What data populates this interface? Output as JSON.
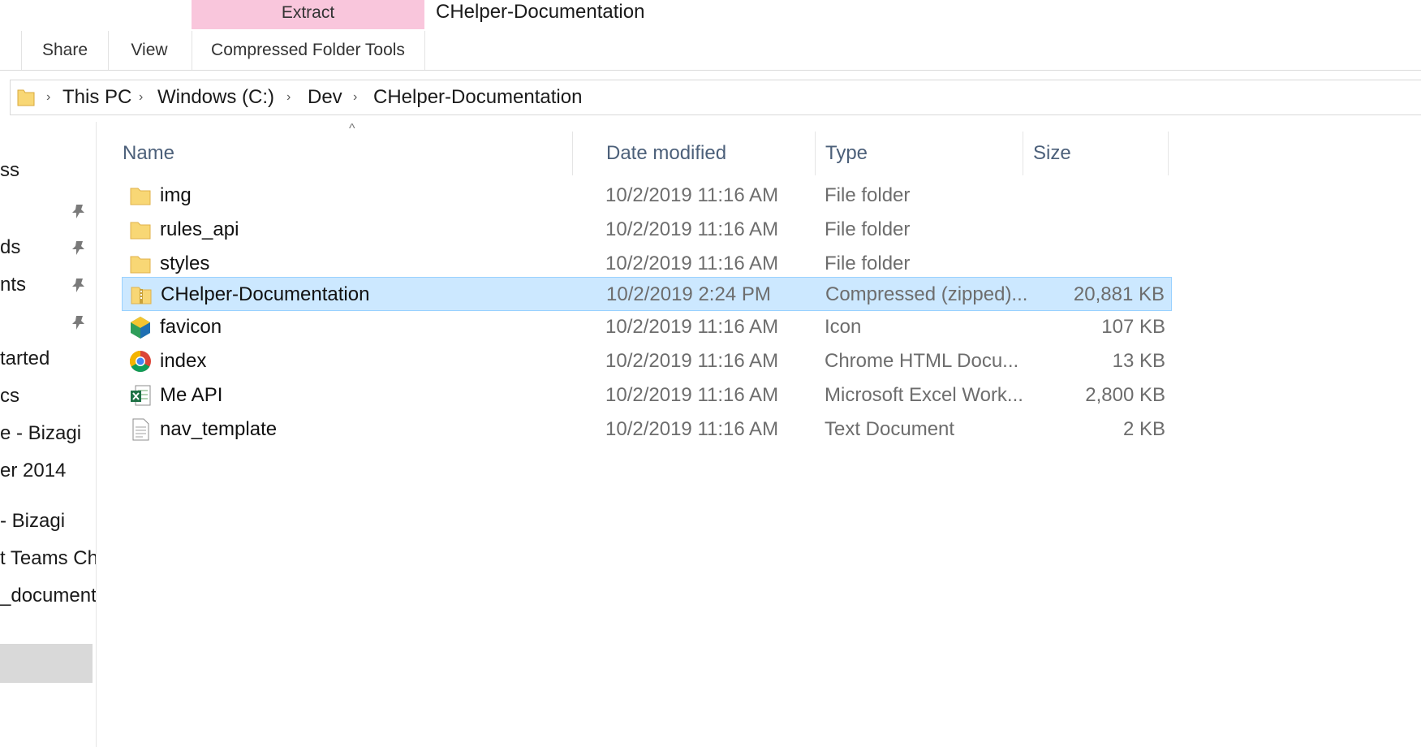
{
  "ribbon": {
    "context_tab_label": "Extract",
    "window_title": "CHelper-Documentation",
    "tabs": [
      {
        "label": "Share"
      },
      {
        "label": "View"
      },
      {
        "label": "Compressed Folder Tools"
      }
    ]
  },
  "address_bar": {
    "crumbs": [
      "This PC",
      "Windows (C:)",
      "Dev",
      "CHelper-Documentation"
    ],
    "separator": "›"
  },
  "nav_pane": {
    "items": [
      {
        "label": "ss",
        "pinned": false
      },
      {
        "label": "",
        "pinned": true
      },
      {
        "label": "ds",
        "pinned": true
      },
      {
        "label": "nts",
        "pinned": true
      },
      {
        "label": "",
        "pinned": true
      },
      {
        "label": "tarted",
        "pinned": false
      },
      {
        "label": "cs",
        "pinned": false
      },
      {
        "label": "e - Bizagi",
        "pinned": false
      },
      {
        "label": "er 2014",
        "pinned": false
      },
      {
        "label": "- Bizagi",
        "pinned": false
      },
      {
        "label": "t Teams Ch",
        "pinned": false
      },
      {
        "label": "_document",
        "pinned": false
      }
    ]
  },
  "file_list": {
    "columns": {
      "name": "Name",
      "date": "Date modified",
      "type": "Type",
      "size": "Size"
    },
    "sort_indicator": "^",
    "rows": [
      {
        "name": "img",
        "date": "10/2/2019 11:16 AM",
        "type": "File folder",
        "size": "",
        "icon": "folder-icon",
        "selected": false
      },
      {
        "name": "rules_api",
        "date": "10/2/2019 11:16 AM",
        "type": "File folder",
        "size": "",
        "icon": "folder-icon",
        "selected": false
      },
      {
        "name": "styles",
        "date": "10/2/2019 11:16 AM",
        "type": "File folder",
        "size": "",
        "icon": "folder-icon",
        "selected": false
      },
      {
        "name": "CHelper-Documentation",
        "date": "10/2/2019 2:24 PM",
        "type": "Compressed (zipped)...",
        "size": "20,881 KB",
        "icon": "zip-folder-icon",
        "selected": true
      },
      {
        "name": "favicon",
        "date": "10/2/2019 11:16 AM",
        "type": "Icon",
        "size": "107 KB",
        "icon": "favicon-icon",
        "selected": false
      },
      {
        "name": "index",
        "date": "10/2/2019 11:16 AM",
        "type": "Chrome HTML Docu...",
        "size": "13 KB",
        "icon": "chrome-icon",
        "selected": false
      },
      {
        "name": "Me API",
        "date": "10/2/2019 11:16 AM",
        "type": "Microsoft Excel Work...",
        "size": "2,800 KB",
        "icon": "excel-icon",
        "selected": false
      },
      {
        "name": "nav_template",
        "date": "10/2/2019 11:16 AM",
        "type": "Text Document",
        "size": "2 KB",
        "icon": "text-document-icon",
        "selected": false
      }
    ]
  },
  "colors": {
    "context_tab": "#f9c6dc",
    "selection_bg": "#cce8ff",
    "selection_border": "#99d1ff",
    "folder_yellow": "#f8d775",
    "header_text": "#4c607a"
  }
}
